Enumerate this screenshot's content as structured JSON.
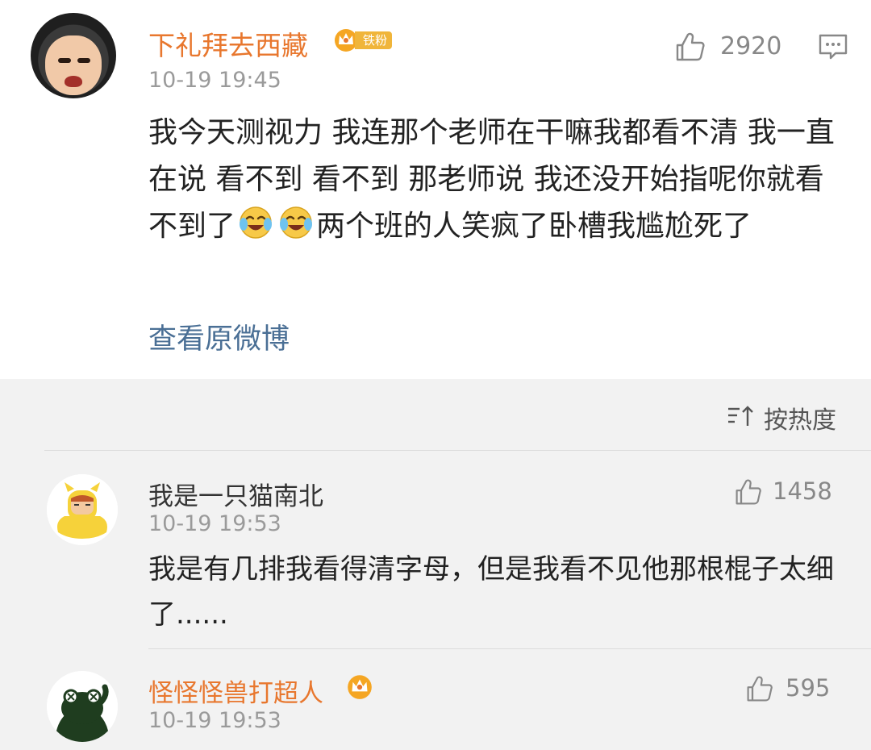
{
  "post": {
    "username": "下礼拜去西藏",
    "badge_label": "铁粉",
    "time": "10-19 19:45",
    "like_count": "2920",
    "content_part1": "我今天测视力 我连那个老师在干嘛我都看不清 我一直在说 看不到 看不到 那老师说 我还没开始指呢你就看不到了",
    "content_part2": "两个班的人笑疯了卧槽我尴尬死了",
    "view_original": "查看原微博",
    "icons": [
      "avatar",
      "crown-icon",
      "thumbs-up-icon",
      "comment-icon",
      "laugh-cry-emoji"
    ]
  },
  "comments_section": {
    "sort_label": "按热度",
    "sort_icon": "sort-icon",
    "comments": [
      {
        "username": "我是一只猫南北",
        "time": "10-19 19:53",
        "like_count": "1458",
        "text": "我是有几排我看得清字母，但是我看不见他那根棍子太细了......"
      },
      {
        "username": "怪怪怪兽打超人",
        "time": "10-19 19:53",
        "like_count": "595",
        "text": ""
      }
    ]
  },
  "colors": {
    "username_orange": "#e8772e",
    "link_blue": "#4a6f95",
    "comments_bg": "#f2f2f2",
    "meta_gray": "#9a9a9a"
  }
}
